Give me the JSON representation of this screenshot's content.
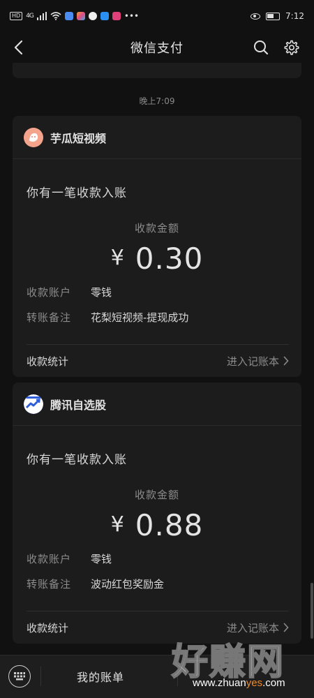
{
  "status_bar": {
    "network_label": "HD",
    "signal_label": "4G",
    "time": "7:12"
  },
  "nav": {
    "title": "微信支付"
  },
  "timestamp": "晚上7:09",
  "cards": [
    {
      "app_name": "芋瓜短视频",
      "message": "你有一笔收款入账",
      "amount_label": "收款金额",
      "currency": "¥",
      "amount": "0.30",
      "account_key": "收款账户",
      "account_value": "零钱",
      "remark_key": "转账备注",
      "remark_value": "花梨短视频-提现成功",
      "footer_left": "收款统计",
      "footer_right": "进入记账本",
      "avatar_color": "#e8846a"
    },
    {
      "app_name": "腾讯自选股",
      "message": "你有一笔收款入账",
      "amount_label": "收款金额",
      "currency": "¥",
      "amount": "0.88",
      "account_key": "收款账户",
      "account_value": "零钱",
      "remark_key": "转账备注",
      "remark_value": "波动红包奖励金",
      "footer_left": "收款统计",
      "footer_right": "进入记账本",
      "avatar_color": "#2e5fd8"
    }
  ],
  "bottom_bar": {
    "tab_1": "我的账单",
    "tab_2": "□□□"
  },
  "watermark": {
    "big": "好赚网",
    "small_pre": "www.zhuan",
    "small_hl": "yes",
    "small_post": ".com"
  }
}
